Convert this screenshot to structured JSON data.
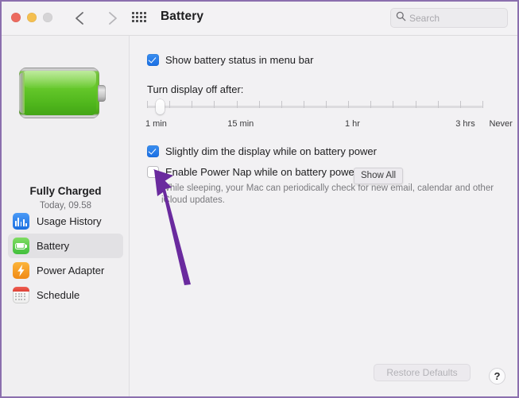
{
  "window": {
    "title": "Battery",
    "accent_blue": "#1a6fe4",
    "border_color": "#8b6fae"
  },
  "toolbar": {
    "traffic_lights": [
      "close-red",
      "minimize-yellow",
      "zoom-disabled-gray"
    ],
    "back_icon": "chevron-left-icon",
    "forward_icon": "chevron-right-icon",
    "grid_icon": "show-all-grid-icon",
    "search": {
      "placeholder": "Search",
      "value": "",
      "icon": "search-icon"
    }
  },
  "sidebar": {
    "battery_image": "battery-full-green-icon",
    "status": "Fully Charged",
    "status_time": "Today, 09.58",
    "items": [
      {
        "label": "Usage History",
        "icon": "usage-history-icon",
        "selected": false
      },
      {
        "label": "Battery",
        "icon": "battery-icon",
        "selected": true
      },
      {
        "label": "Power Adapter",
        "icon": "power-adapter-bolt-icon",
        "selected": false
      },
      {
        "label": "Schedule",
        "icon": "schedule-calendar-icon",
        "selected": false
      }
    ]
  },
  "main": {
    "show_battery_status": {
      "label": "Show battery status in menu bar",
      "checked": true
    },
    "turn_display_off_label": "Turn display off after:",
    "slider": {
      "value_label": "1 min",
      "value_percent": 4,
      "tick_count": 16,
      "labels": [
        {
          "text": "1 min",
          "percent": 0
        },
        {
          "text": "15 min",
          "percent": 24
        },
        {
          "text": "1 hr",
          "percent": 59
        },
        {
          "text": "3 hrs",
          "percent": 92
        },
        {
          "text": "Never",
          "percent": 102
        }
      ]
    },
    "slightly_dim": {
      "label": "Slightly dim the display while on battery power",
      "checked": true
    },
    "power_nap": {
      "label": "Enable Power Nap while on battery power",
      "checked": false,
      "description": "While sleeping, your Mac can periodically check for new email, calendar and other iCloud updates."
    },
    "tooltip": "Show All",
    "restore_defaults_label": "Restore Defaults",
    "help_label": "?"
  },
  "annotation": {
    "arrow_color": "#6a2a9e",
    "arrow_name": "purple-pointer-arrow"
  }
}
